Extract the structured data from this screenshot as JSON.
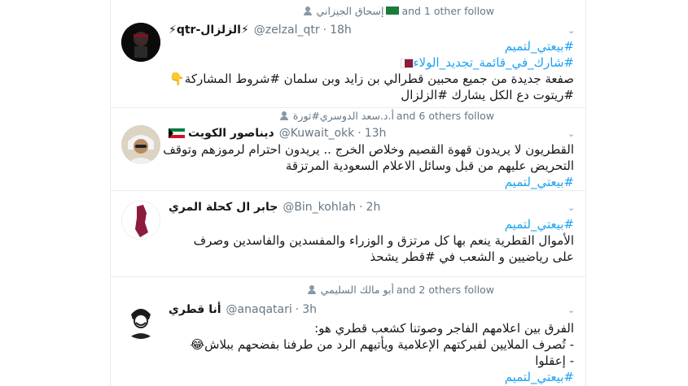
{
  "tweets": [
    {
      "context": {
        "name": "إسحاق الجيزاني",
        "suffix": "and 1 other follow"
      },
      "display_name": "⚡qtr-الزلزال⚡",
      "handle": "@zelzal_qtr",
      "sep": "·",
      "time": "18h",
      "lines": [
        "#بيعتي_لتميم",
        "#شارك_في_قائمة_تجديد_الولاء",
        "صفعة جديدة من جميع محبين قطرالي بن زايد وبن سلمان #شروط المشاركة👇",
        "#ريتوت دع الكل يشارك #الزلزال"
      ]
    },
    {
      "context": {
        "name": "أ.د.سعد الدوسري#ثورة",
        "suffix": "and 6 others follow"
      },
      "display_name": "ديناصور الكويت",
      "handle": "@Kuwait_okk",
      "sep": "·",
      "time": "13h",
      "lines": [
        "القطريون لا يريدون قهوة القصيم وخلاص الخرج .. يريدون احترام لرموزهم وتوقف",
        "التحريض عليهم من قبل وسائل الاعلام السعودية المرتزقة",
        "#بيعتي_لتميم"
      ]
    },
    {
      "display_name": "جابر ال كحلة المري",
      "handle": "@Bin_kohlah",
      "sep": "·",
      "time": "2h",
      "lines": [
        "#بيعتي_لتميم",
        "الأموال القطرية ينعم بها كل مرتزق و الوزراء والمفسدين والفاسدين وصرف",
        "على رياضيين و الشعب في #قطر يشحذ"
      ]
    },
    {
      "context": {
        "name": "أبو مالك السليمي",
        "suffix": "and 2 others follow"
      },
      "display_name": "أنا قطري",
      "handle": "@anaqatari",
      "sep": "·",
      "time": "3h",
      "lines": [
        "الفرق بين اعلامهم الفاجر وصوتنا كشعب قطري هو:",
        "- تُصرف الملايين لفبركتهم الإعلامية ويأتيهم الرد من طرفنا بفضحهم ببلاش😂",
        "- إعقلوا",
        "#بيعتي_لتميم"
      ]
    }
  ],
  "colors": {
    "link": "#1da1f2",
    "muted": "#657786",
    "border": "#e6ecf0"
  }
}
